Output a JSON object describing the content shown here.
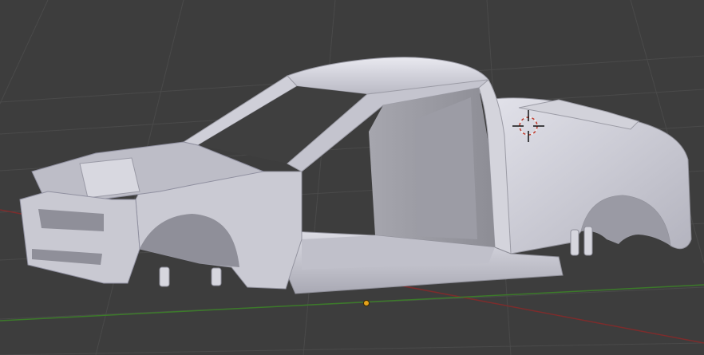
{
  "viewport": {
    "background": "#3d3d3d",
    "grid_color": "#4b4b4b",
    "x_axis_color": "#8a2f2f",
    "y_axis_color": "#3f7f2a",
    "origin_color": "#e6a21b",
    "cursor_color": "#b22222",
    "mesh_color": "#c8c8d2"
  },
  "scene": {
    "object": "car-body-shell",
    "cursor_icon": "3d-cursor-icon",
    "origin_icon": "object-origin-icon"
  }
}
